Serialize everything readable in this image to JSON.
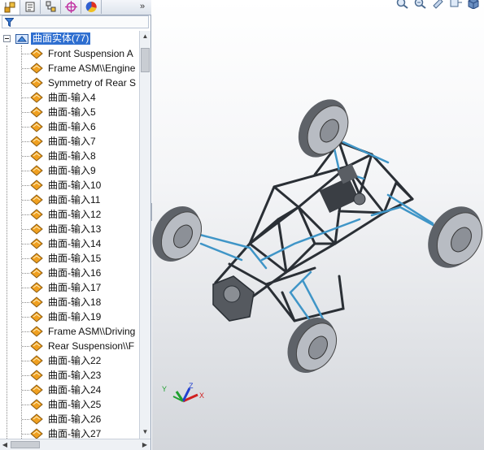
{
  "panel": {
    "tabs": [
      {
        "name": "feature-manager-tab",
        "icon": "feature-tree-icon"
      },
      {
        "name": "property-manager-tab",
        "icon": "property-icon"
      },
      {
        "name": "configuration-manager-tab",
        "icon": "configuration-icon"
      },
      {
        "name": "dimxpert-manager-tab",
        "icon": "crosshair-icon"
      },
      {
        "name": "display-manager-tab",
        "icon": "color-wheel-icon"
      }
    ],
    "more_tabs": "»",
    "filter_icon": "filter-icon"
  },
  "tree": {
    "root_label": "曲面实体(77)",
    "items": [
      "Front Suspension A",
      "Frame ASM\\\\Engine",
      "Symmetry of Rear S",
      "曲面-输入4",
      "曲面-输入5",
      "曲面-输入6",
      "曲面-输入7",
      "曲面-输入8",
      "曲面-输入9",
      "曲面-输入10",
      "曲面-输入11",
      "曲面-输入12",
      "曲面-输入13",
      "曲面-输入14",
      "曲面-输入15",
      "曲面-输入16",
      "曲面-输入17",
      "曲面-输入18",
      "曲面-输入19",
      "Frame ASM\\\\Driving",
      "Rear Suspension\\\\F",
      "曲面-输入22",
      "曲面-输入23",
      "曲面-输入24",
      "曲面-输入25",
      "曲面-输入26",
      "曲面-输入27"
    ]
  },
  "viewport": {
    "toolbar_icons": [
      "zoom-to-fit-icon",
      "zoom-area-icon",
      "previous-view-icon",
      "section-view-icon",
      "view-orientation-icon"
    ],
    "triad": {
      "x": "X",
      "y": "Y",
      "z": "Z"
    }
  },
  "colors": {
    "selection": "#2f6fd0",
    "frame_tube": "#2a2f35",
    "accent_tube": "#3f95c7",
    "tire": "#5e6268",
    "surface_icon": "#f0a020"
  }
}
